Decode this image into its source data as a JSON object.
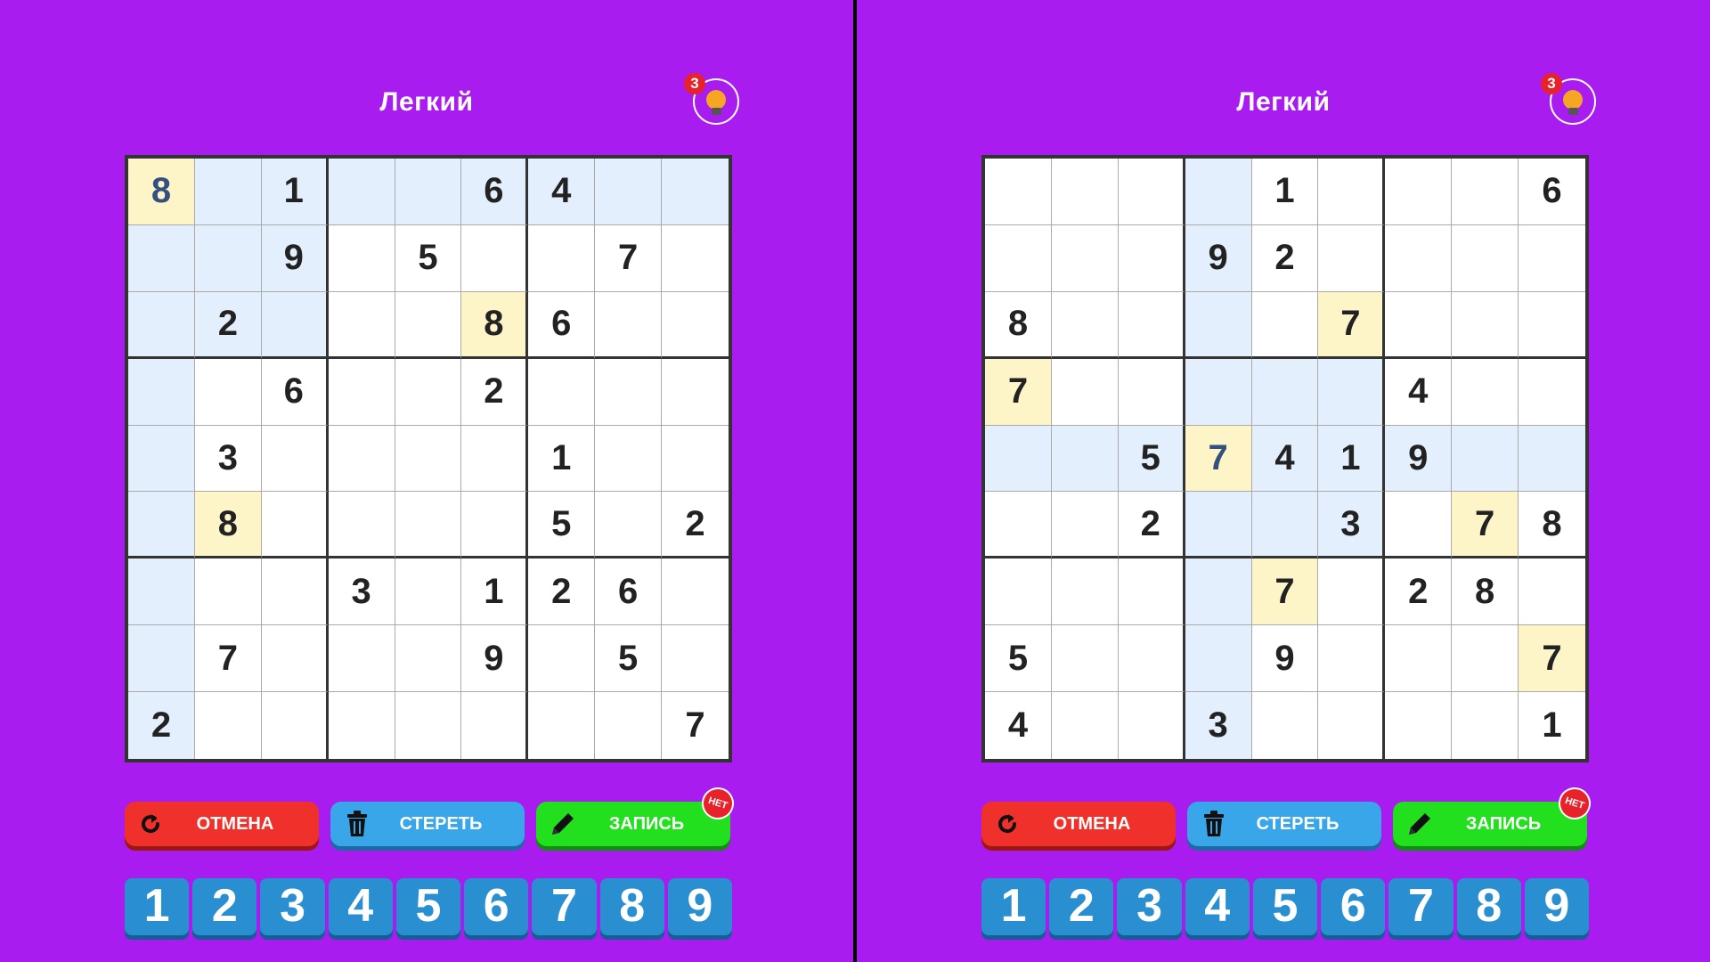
{
  "screens": [
    {
      "title": "Легкий",
      "hints": "3",
      "board": [
        [
          "8",
          "",
          "1",
          "",
          "",
          "6",
          "4",
          "",
          ""
        ],
        [
          "",
          "",
          "9",
          "",
          "5",
          "",
          "",
          "7",
          ""
        ],
        [
          "",
          "2",
          "",
          "",
          "",
          "8",
          "6",
          "",
          ""
        ],
        [
          "",
          "",
          "6",
          "",
          "",
          "2",
          "",
          "",
          ""
        ],
        [
          "",
          "3",
          "",
          "",
          "",
          "",
          "1",
          "",
          ""
        ],
        [
          "",
          "8",
          "",
          "",
          "",
          "",
          "5",
          "",
          "2"
        ],
        [
          "",
          "",
          "",
          "3",
          "",
          "1",
          "2",
          "6",
          ""
        ],
        [
          "",
          "7",
          "",
          "",
          "",
          "9",
          "",
          "5",
          ""
        ],
        [
          "2",
          "",
          "",
          "",
          "",
          "",
          "",
          "",
          "7"
        ]
      ],
      "cell_states": [
        [
          "sel",
          "hl",
          "hl",
          "hl",
          "hl",
          "hl",
          "hl",
          "hl",
          "hl"
        ],
        [
          "hl",
          "hl",
          "hl",
          "",
          "",
          "",
          "",
          "",
          ""
        ],
        [
          "hl",
          "hl",
          "hl",
          "",
          "",
          "sm",
          "",
          "",
          ""
        ],
        [
          "hl",
          "",
          "",
          "",
          "",
          "",
          "",
          "",
          ""
        ],
        [
          "hl",
          "",
          "",
          "",
          "",
          "",
          "",
          "",
          ""
        ],
        [
          "hl",
          "sm",
          "",
          "",
          "",
          "",
          "",
          "",
          ""
        ],
        [
          "hl",
          "",
          "",
          "",
          "",
          "",
          "",
          "",
          ""
        ],
        [
          "hl",
          "",
          "",
          "",
          "",
          "",
          "",
          "",
          ""
        ],
        [
          "hl",
          "",
          "",
          "",
          "",
          "",
          "",
          "",
          ""
        ]
      ],
      "undo_label": "ОТМЕНА",
      "erase_label": "СТЕРЕТЬ",
      "notes_label": "ЗАПИСЬ",
      "notes_badge": "НЕТ",
      "digits": [
        "1",
        "2",
        "3",
        "4",
        "5",
        "6",
        "7",
        "8",
        "9"
      ]
    },
    {
      "title": "Легкий",
      "hints": "3",
      "board": [
        [
          "",
          "",
          "",
          "",
          "1",
          "",
          "",
          "",
          "6"
        ],
        [
          "",
          "",
          "",
          "9",
          "2",
          "",
          "",
          "",
          ""
        ],
        [
          "8",
          "",
          "",
          "",
          "",
          "7",
          "",
          "",
          ""
        ],
        [
          "7",
          "",
          "",
          "",
          "",
          "",
          "4",
          "",
          ""
        ],
        [
          "",
          "",
          "5",
          "7",
          "4",
          "1",
          "9",
          "",
          ""
        ],
        [
          "",
          "",
          "2",
          "",
          "",
          "3",
          "",
          "7",
          "8"
        ],
        [
          "",
          "",
          "",
          "",
          "7",
          "",
          "2",
          "8",
          ""
        ],
        [
          "5",
          "",
          "",
          "",
          "9",
          "",
          "",
          "",
          "7"
        ],
        [
          "4",
          "",
          "",
          "3",
          "",
          "",
          "",
          "",
          "1"
        ]
      ],
      "cell_states": [
        [
          "",
          "",
          "",
          "hl",
          "",
          "",
          "",
          "",
          ""
        ],
        [
          "",
          "",
          "",
          "hl",
          "",
          "",
          "",
          "",
          ""
        ],
        [
          "",
          "",
          "",
          "hl",
          "",
          "sm",
          "",
          "",
          ""
        ],
        [
          "sm",
          "",
          "",
          "hl",
          "hl",
          "hl",
          "",
          "",
          ""
        ],
        [
          "hl",
          "hl",
          "hl",
          "sel",
          "hl",
          "hl",
          "hl",
          "hl",
          "hl"
        ],
        [
          "",
          "",
          "",
          "hl",
          "hl",
          "hl",
          "",
          "sm",
          ""
        ],
        [
          "",
          "",
          "",
          "hl",
          "sm",
          "",
          "",
          "",
          ""
        ],
        [
          "",
          "",
          "",
          "hl",
          "",
          "",
          "",
          "",
          "sm"
        ],
        [
          "",
          "",
          "",
          "hl",
          "",
          "",
          "",
          "",
          ""
        ]
      ],
      "undo_label": "ОТМЕНА",
      "erase_label": "СТЕРЕТЬ",
      "notes_label": "ЗАПИСЬ",
      "notes_badge": "НЕТ",
      "digits": [
        "1",
        "2",
        "3",
        "4",
        "5",
        "6",
        "7",
        "8",
        "9"
      ]
    }
  ],
  "icons": {
    "hint": "lightbulb-icon",
    "undo": "undo-arrow-icon",
    "erase": "trash-icon",
    "notes": "pencil-icon"
  }
}
